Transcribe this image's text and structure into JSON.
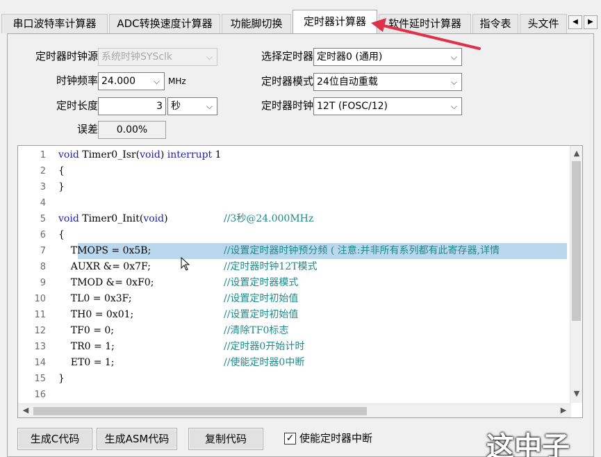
{
  "tabs": [
    {
      "label": "串口波特率计算器"
    },
    {
      "label": "ADC转换速度计算器"
    },
    {
      "label": "功能脚切换"
    },
    {
      "label": "定时器计算器"
    },
    {
      "label": "软件延时计算器"
    },
    {
      "label": "指令表"
    },
    {
      "label": "头文件"
    }
  ],
  "active_tab": "定时器计算器",
  "form": {
    "clock_source_label": "定时器时钟源",
    "clock_source_value": "系统时钟SYSclk",
    "clock_freq_label": "时钟频率",
    "clock_freq_value": "24.000",
    "clock_freq_unit": "MHz",
    "duration_label": "定时长度",
    "duration_value": "3",
    "duration_unit": "秒",
    "error_label": "误差",
    "error_value": "0.00%",
    "timer_select_label": "选择定时器",
    "timer_select_value": "定时器0 (通用)",
    "timer_mode_label": "定时器模式",
    "timer_mode_value": "24位自动重载",
    "timer_clock_label": "定时器时钟",
    "timer_clock_value": "12T (FOSC/12)"
  },
  "code_lines": [
    {
      "n": "1",
      "code_kw": "void",
      "code": " Timer0_Isr(",
      "code_kw2": "void",
      "code2": ") ",
      "code_kw3": "interrupt",
      "code3": " 1",
      "comment": ""
    },
    {
      "n": "2",
      "code_kw": "",
      "code": "{",
      "code_kw2": "",
      "code2": "",
      "code_kw3": "",
      "code3": "",
      "comment": ""
    },
    {
      "n": "3",
      "code_kw": "",
      "code": "}",
      "code_kw2": "",
      "code2": "",
      "code_kw3": "",
      "code3": "",
      "comment": ""
    },
    {
      "n": "4",
      "code_kw": "",
      "code": "",
      "code_kw2": "",
      "code2": "",
      "code_kw3": "",
      "code3": "",
      "comment": ""
    },
    {
      "n": "5",
      "code_kw": "void",
      "code": " Timer0_Init(",
      "code_kw2": "void",
      "code2": ")",
      "code_kw3": "",
      "code3": "",
      "comment": "//3秒@24.000MHz"
    },
    {
      "n": "6",
      "code_kw": "",
      "code": "{",
      "code_kw2": "",
      "code2": "",
      "code_kw3": "",
      "code3": "",
      "comment": ""
    },
    {
      "n": "7",
      "code_kw": "",
      "code": "    TMOPS = 0x5B;",
      "code_kw2": "",
      "code2": "",
      "code_kw3": "",
      "code3": "",
      "comment": "//设置定时器时钟预分频 ( 注意:并非所有系列都有此寄存器,详情"
    },
    {
      "n": "8",
      "code_kw": "",
      "code": "    AUXR &= 0x7F;",
      "code_kw2": "",
      "code2": "",
      "code_kw3": "",
      "code3": "",
      "comment": "//定时器时钟12T模式"
    },
    {
      "n": "9",
      "code_kw": "",
      "code": "    TMOD &= 0xF0;",
      "code_kw2": "",
      "code2": "",
      "code_kw3": "",
      "code3": "",
      "comment": "//设置定时器模式"
    },
    {
      "n": "10",
      "code_kw": "",
      "code": "    TL0 = 0x3F;",
      "code_kw2": "",
      "code2": "",
      "code_kw3": "",
      "code3": "",
      "comment": "//设置定时初始值"
    },
    {
      "n": "11",
      "code_kw": "",
      "code": "    TH0 = 0x01;",
      "code_kw2": "",
      "code2": "",
      "code_kw3": "",
      "code3": "",
      "comment": "//设置定时初始值"
    },
    {
      "n": "12",
      "code_kw": "",
      "code": "    TF0 = 0;",
      "code_kw2": "",
      "code2": "",
      "code_kw3": "",
      "code3": "",
      "comment": "//清除TF0标志"
    },
    {
      "n": "13",
      "code_kw": "",
      "code": "    TR0 = 1;",
      "code_kw2": "",
      "code2": "",
      "code_kw3": "",
      "code3": "",
      "comment": "//定时器0开始计时"
    },
    {
      "n": "14",
      "code_kw": "",
      "code": "    ET0 = 1;",
      "code_kw2": "",
      "code2": "",
      "code_kw3": "",
      "code3": "",
      "comment": "//使能定时器0中断"
    },
    {
      "n": "15",
      "code_kw": "",
      "code": "}",
      "code_kw2": "",
      "code2": "",
      "code_kw3": "",
      "code3": "",
      "comment": ""
    },
    {
      "n": "16",
      "code_kw": "",
      "code": "",
      "code_kw2": "",
      "code2": "",
      "code_kw3": "",
      "code3": "",
      "comment": ""
    }
  ],
  "highlighted_line": "7",
  "buttons": {
    "gen_c": "生成C代码",
    "gen_asm": "生成ASM代码",
    "copy": "复制代码"
  },
  "enable_interrupt": {
    "label": "使能定时器中断",
    "checked": true,
    "check_glyph": "✓"
  },
  "overlay_text": "这中子",
  "colors": {
    "keyword": "#1f1fa8",
    "comment": "#1c8a8a",
    "highlight": "#b9d8ee",
    "annotation_arrow": "#e0304a"
  },
  "icons": {
    "tab_left": "◀",
    "tab_right": "▶",
    "dropdown": "⌵",
    "scroll_up": "▲",
    "scroll_down": "▼",
    "scroll_left": "◀",
    "scroll_right": "▶"
  }
}
